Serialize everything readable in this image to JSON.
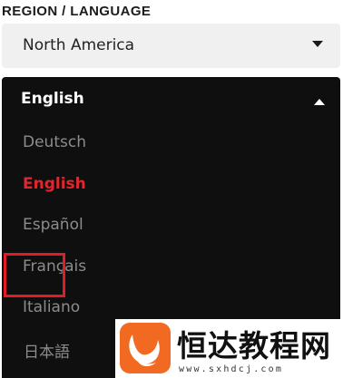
{
  "region_section": {
    "label": "REGION / LANGUAGE",
    "selected_region": "North America"
  },
  "language_dropdown": {
    "selected": "English",
    "options": [
      {
        "label": "Deutsch"
      },
      {
        "label": "English",
        "active": true
      },
      {
        "label": "Español"
      },
      {
        "label": "Français"
      },
      {
        "label": "Italiano"
      },
      {
        "label": "日本語",
        "highlighted": true
      }
    ]
  },
  "watermark": {
    "title": "恒达教程网",
    "url": "www.sxhdcj.com",
    "logo_icon": "fox-tail-logo-icon"
  },
  "colors": {
    "dropdown_bg": "#0f0f0f",
    "active_option": "#e0262e",
    "highlight_border": "#e31b23",
    "logo_orange": "#f26a22"
  }
}
